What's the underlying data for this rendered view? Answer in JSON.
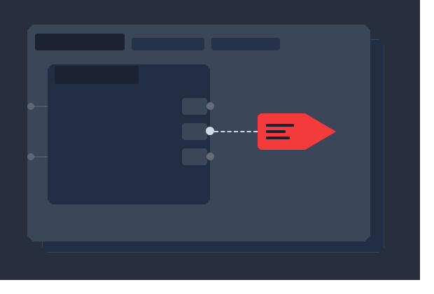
{
  "colors": {
    "background": "#272e3d",
    "window": "#3b4659",
    "panel": "#212e44",
    "tab_dark": "#1a2233",
    "tab_mid": "#26344a",
    "output_tag": "#f43b3b",
    "active_port": "#d0d9e7"
  },
  "icons": {
    "output_tag": "tag-icon"
  }
}
